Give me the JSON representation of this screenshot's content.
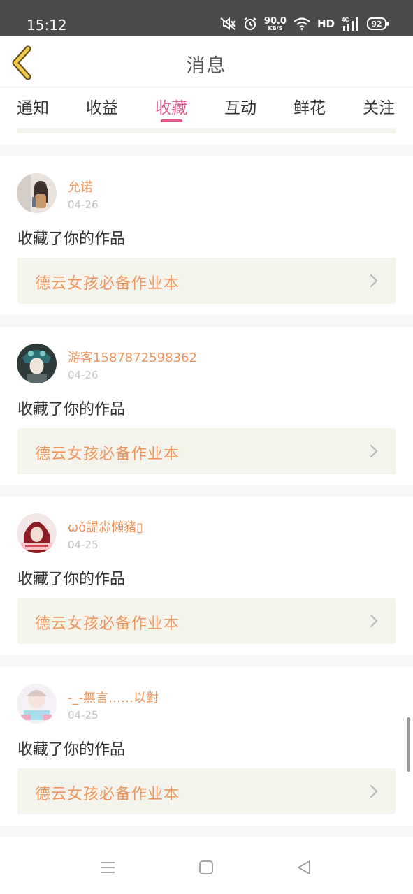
{
  "status_bar": {
    "time": "15:12",
    "net_speed_value": "90.0",
    "net_speed_unit": "KB/S",
    "hd_label": "HD",
    "network_label": "4G",
    "battery": "92",
    "icons": [
      "mute-icon",
      "alarm-icon",
      "wifi-icon",
      "signal-icon",
      "battery-icon"
    ]
  },
  "header": {
    "title": "消息",
    "back_icon": "chevron-left-icon"
  },
  "tabs": [
    {
      "label": "通知",
      "active": false
    },
    {
      "label": "收益",
      "active": false
    },
    {
      "label": "收藏",
      "active": true
    },
    {
      "label": "互动",
      "active": false
    },
    {
      "label": "鲜花",
      "active": false
    },
    {
      "label": "关注",
      "active": false
    }
  ],
  "notifications": [
    {
      "username": "允诺",
      "date": "04-26",
      "action": "收藏了你的作品",
      "work_title": "德云女孩必备作业本"
    },
    {
      "username": "游客1587872598362",
      "date": "04-26",
      "action": "收藏了你的作品",
      "work_title": "德云女孩必备作业本"
    },
    {
      "username": "ωǒ諟尛懶豬▯",
      "date": "04-25",
      "action": "收藏了你的作品",
      "work_title": "德云女孩必备作业本"
    },
    {
      "username": "-_-無言……以對",
      "date": "04-25",
      "action": "收藏了你的作品",
      "work_title": "德云女孩必备作业本"
    }
  ],
  "colors": {
    "accent_pink": "#e05a8f",
    "username_orange": "#f0955b",
    "back_arrow_yellow": "#f2c94c",
    "link_bg": "#f4f3ec"
  },
  "nav_bar": {
    "icons": [
      "menu-icon",
      "home-square-icon",
      "back-triangle-icon"
    ]
  }
}
